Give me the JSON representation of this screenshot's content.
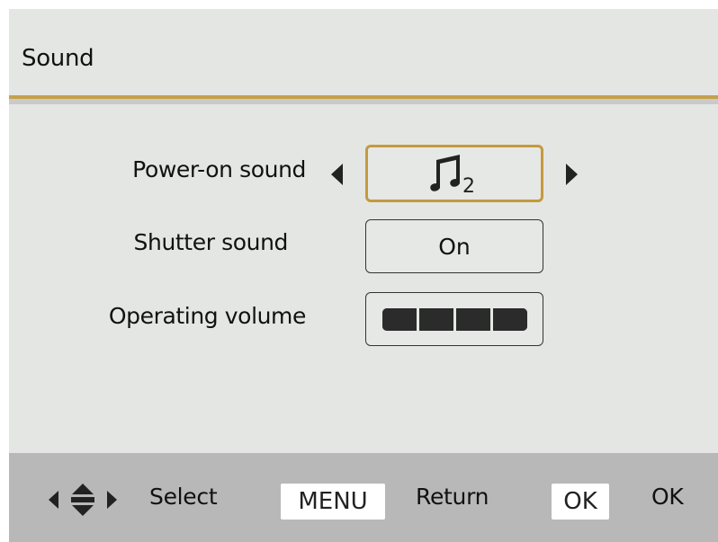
{
  "header": {
    "title": "Sound"
  },
  "settings": {
    "power_on_sound": {
      "label": "Power-on sound",
      "value_icon": "music-note-icon",
      "value_sub": "2"
    },
    "shutter_sound": {
      "label": "Shutter sound",
      "value": "On"
    },
    "operating_volume": {
      "label": "Operating volume",
      "level": 4,
      "max_level": 4
    }
  },
  "footer": {
    "nav_icon": "four-way-dpad-icon",
    "select_label": "Select",
    "menu_key": "MENU",
    "return_label": "Return",
    "ok_key": "OK",
    "ok_label": "OK"
  },
  "colors": {
    "background": "#e4e6e4",
    "accent_gold": "#c49a3e",
    "footer_bg": "#b7b8b7"
  }
}
